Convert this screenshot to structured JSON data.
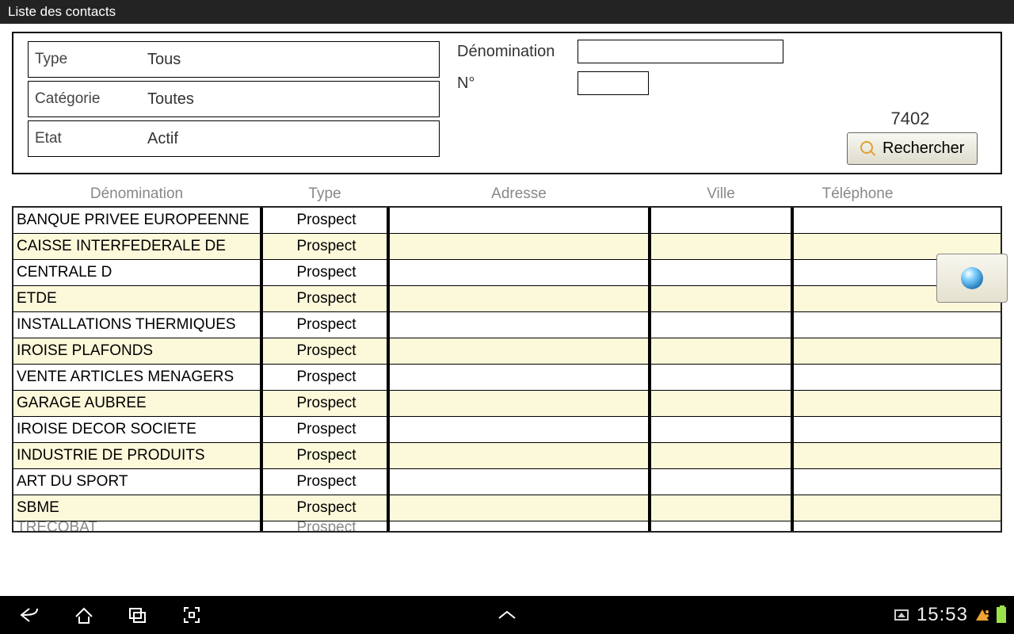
{
  "header": {
    "title": "Liste des contacts"
  },
  "filters": {
    "type_label": "Type",
    "type_value": "Tous",
    "category_label": "Catégorie",
    "category_value": "Toutes",
    "state_label": "Etat",
    "state_value": "Actif"
  },
  "search": {
    "denom_label": "Dénomination",
    "denom_value": "",
    "num_label": "N°",
    "num_value": "",
    "count": "7402",
    "button_label": "Rechercher"
  },
  "columns": {
    "denom": "Dénomination",
    "type": "Type",
    "addr": "Adresse",
    "ville": "Ville",
    "tel": "Téléphone"
  },
  "rows": [
    {
      "denom": "BANQUE PRIVEE EUROPEENNE",
      "type": "Prospect",
      "addr": "",
      "ville": "",
      "tel": ""
    },
    {
      "denom": "CAISSE INTERFEDERALE DE",
      "type": "Prospect",
      "addr": "",
      "ville": "",
      "tel": ""
    },
    {
      "denom": "CENTRALE D",
      "type": "Prospect",
      "addr": "",
      "ville": "",
      "tel": ""
    },
    {
      "denom": "ETDE",
      "type": "Prospect",
      "addr": "",
      "ville": "",
      "tel": ""
    },
    {
      "denom": "INSTALLATIONS THERMIQUES",
      "type": "Prospect",
      "addr": "",
      "ville": "",
      "tel": ""
    },
    {
      "denom": "IROISE PLAFONDS",
      "type": "Prospect",
      "addr": "",
      "ville": "",
      "tel": ""
    },
    {
      "denom": "VENTE ARTICLES MENAGERS",
      "type": "Prospect",
      "addr": "",
      "ville": "",
      "tel": ""
    },
    {
      "denom": "GARAGE AUBREE",
      "type": "Prospect",
      "addr": "",
      "ville": "",
      "tel": ""
    },
    {
      "denom": "IROISE DECOR SOCIETE",
      "type": "Prospect",
      "addr": "",
      "ville": "",
      "tel": ""
    },
    {
      "denom": "INDUSTRIE DE PRODUITS",
      "type": "Prospect",
      "addr": "",
      "ville": "",
      "tel": ""
    },
    {
      "denom": "ART DU SPORT",
      "type": "Prospect",
      "addr": "",
      "ville": "",
      "tel": ""
    },
    {
      "denom": "SBME",
      "type": "Prospect",
      "addr": "",
      "ville": "",
      "tel": ""
    }
  ],
  "partial_row": {
    "denom": "TRECOBAT",
    "type": "Prospect"
  },
  "statusbar": {
    "time": "15:53"
  }
}
